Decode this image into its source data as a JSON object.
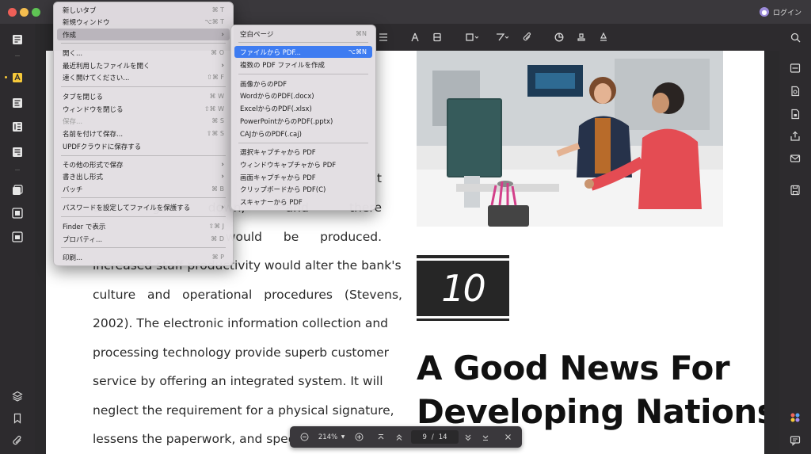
{
  "window": {
    "login_label": "ログイン"
  },
  "menu": {
    "items": [
      {
        "label": "新しいタブ",
        "shortcut": "⌘ T"
      },
      {
        "label": "新規ウィンドウ",
        "shortcut": "⌥⌘ T"
      },
      {
        "label": "作成",
        "shortcut": "",
        "arrow": "›"
      },
      {
        "label": "開く...",
        "shortcut": "⌘ O"
      },
      {
        "label": "最近利用したファイルを開く",
        "shortcut": "",
        "arrow": "›"
      },
      {
        "label": "速く開けてください...",
        "shortcut": "⇧⌘ F"
      },
      {
        "label": "タブを閉じる",
        "shortcut": "⌘ W"
      },
      {
        "label": "ウィンドウを閉じる",
        "shortcut": "⇧⌘ W"
      },
      {
        "label": "保存...",
        "shortcut": "⌘ S"
      },
      {
        "label": "名前を付けて保存...",
        "shortcut": "⇧⌘ S"
      },
      {
        "label": "UPDFクラウドに保存する",
        "shortcut": ""
      },
      {
        "label": "その他の形式で保存",
        "shortcut": "",
        "arrow": "›"
      },
      {
        "label": "書き出し形式",
        "shortcut": "",
        "arrow": "›"
      },
      {
        "label": "バッチ",
        "shortcut": "⌘ B"
      },
      {
        "label": "パスワードを設定してファイルを保護する",
        "shortcut": "",
        "arrow": "›"
      },
      {
        "label": "Finder で表示",
        "shortcut": "⇧⌘ J"
      },
      {
        "label": "プロパティ...",
        "shortcut": "⌘ D"
      },
      {
        "label": "印刷...",
        "shortcut": "⌘ P"
      }
    ]
  },
  "submenu": {
    "items": [
      {
        "label": "空白ページ",
        "shortcut": "⌘N"
      },
      {
        "label": "ファイルから PDF...",
        "shortcut": "⌥⌘N"
      },
      {
        "label": "複数の PDF ファイルを作成",
        "shortcut": ""
      },
      {
        "label": "画像からのPDF",
        "shortcut": ""
      },
      {
        "label": "WordからのPDF(.docx)",
        "shortcut": ""
      },
      {
        "label": "ExcelからのPDF(.xlsx)",
        "shortcut": ""
      },
      {
        "label": "PowerPointからのPDF(.pptx)",
        "shortcut": ""
      },
      {
        "label": "CAJからのPDF(.caj)",
        "shortcut": ""
      },
      {
        "label": "選択キャプチャから PDF",
        "shortcut": ""
      },
      {
        "label": "ウィンドウキャプチャから PDF",
        "shortcut": ""
      },
      {
        "label": "画面キャプチャから PDF",
        "shortcut": ""
      },
      {
        "label": "クリップボードから PDF(C)",
        "shortcut": ""
      },
      {
        "label": "スキャナーから PDF",
        "shortcut": ""
      }
    ]
  },
  "document": {
    "lines": [
      "t",
      "uld go down, and there",
      "would be produced.",
      "increased staff productivity would alter the bank's",
      "culture and operational procedures (Stevens,",
      "2002). The electronic information collection and",
      "processing technology provide superb customer",
      "service by offering an integrated system. It will",
      "neglect the requirement for a physical signature,",
      "lessens the paperwork, and spee"
    ],
    "badge_number": "10",
    "headline_1": "A Good News For",
    "headline_2": "Developing Nations"
  },
  "pagenav": {
    "zoom": "214%",
    "current_page": "9",
    "separator": "/",
    "total_pages": "14"
  },
  "icons": [
    "reader-icon",
    "highlighter-icon",
    "edit-text-icon",
    "organize-pages-icon",
    "form-icon",
    "convert-icon",
    "compress-icon",
    "protect-icon",
    "layers-icon",
    "bookmark-icon",
    "attachment-icon",
    "search-icon",
    "ocr-icon",
    "share-icon",
    "mail-icon",
    "save-icon",
    "ai-icon",
    "comment-icon"
  ],
  "colors": {
    "selection": "#3e7cf1",
    "chrome": "#2d2b2e",
    "badge": "#262626"
  }
}
